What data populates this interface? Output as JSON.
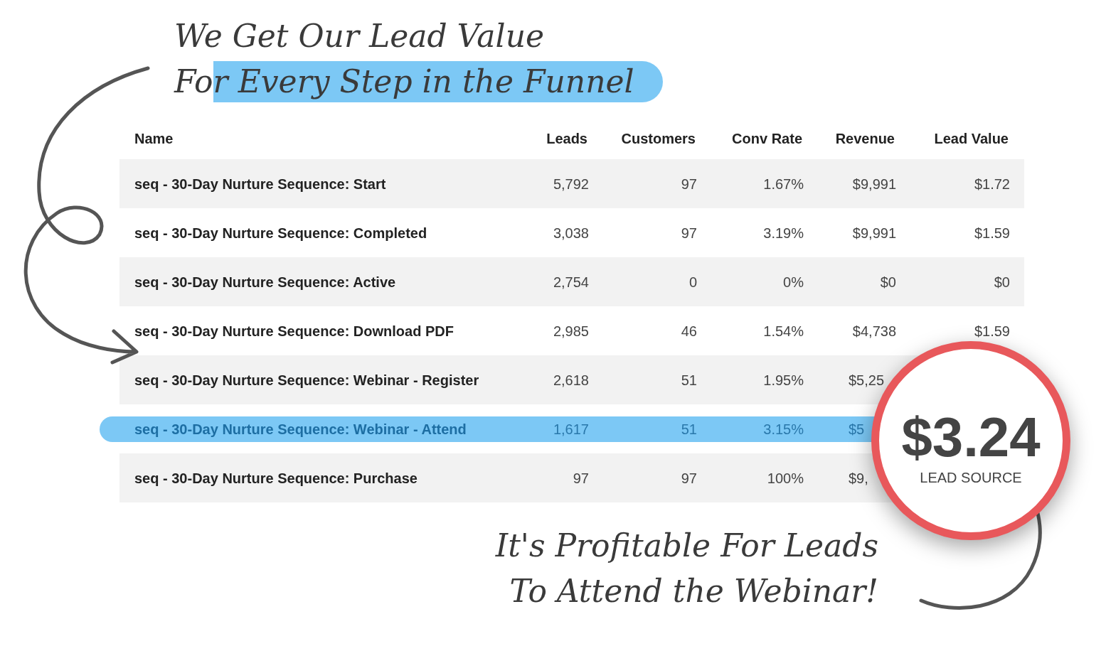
{
  "headline": {
    "lines": [
      "We Get Our Lead Value",
      "For Every Step in the Funnel"
    ]
  },
  "table": {
    "columns": [
      "Name",
      "Leads",
      "Customers",
      "Conv Rate",
      "Revenue",
      "Lead Value"
    ],
    "rows": [
      {
        "name": "seq - 30-Day Nurture Sequence: Start",
        "leads": "5,792",
        "customers": "97",
        "conv_rate": "1.67%",
        "revenue": "$9,991",
        "lead_value": "$1.72",
        "highlighted": false
      },
      {
        "name": "seq - 30-Day Nurture Sequence: Completed",
        "leads": "3,038",
        "customers": "97",
        "conv_rate": "3.19%",
        "revenue": "$9,991",
        "lead_value": "$1.59",
        "highlighted": false
      },
      {
        "name": "seq - 30-Day Nurture Sequence: Active",
        "leads": "2,754",
        "customers": "0",
        "conv_rate": "0%",
        "revenue": "$0",
        "lead_value": "$0",
        "highlighted": false
      },
      {
        "name": "seq - 30-Day Nurture Sequence: Download PDF",
        "leads": "2,985",
        "customers": "46",
        "conv_rate": "1.54%",
        "revenue": "$4,738",
        "lead_value": "$1.59",
        "highlighted": false
      },
      {
        "name": "seq - 30-Day Nurture Sequence: Webinar - Register",
        "leads": "2,618",
        "customers": "51",
        "conv_rate": "1.95%",
        "revenue": "$5,25",
        "highlighted": false
      },
      {
        "name": "seq - 30-Day Nurture Sequence: Webinar - Attend",
        "leads": "1,617",
        "customers": "51",
        "conv_rate": "3.15%",
        "revenue": "$5",
        "highlighted": true
      },
      {
        "name": "seq - 30-Day Nurture Sequence: Purchase",
        "leads": "97",
        "customers": "97",
        "conv_rate": "100%",
        "revenue": "$9,",
        "highlighted": false
      }
    ]
  },
  "callout": {
    "value": "$3.24",
    "label": "LEAD SOURCE"
  },
  "footnote": {
    "lines": [
      "It's Profitable For Leads",
      "To Attend the Webinar!"
    ]
  }
}
